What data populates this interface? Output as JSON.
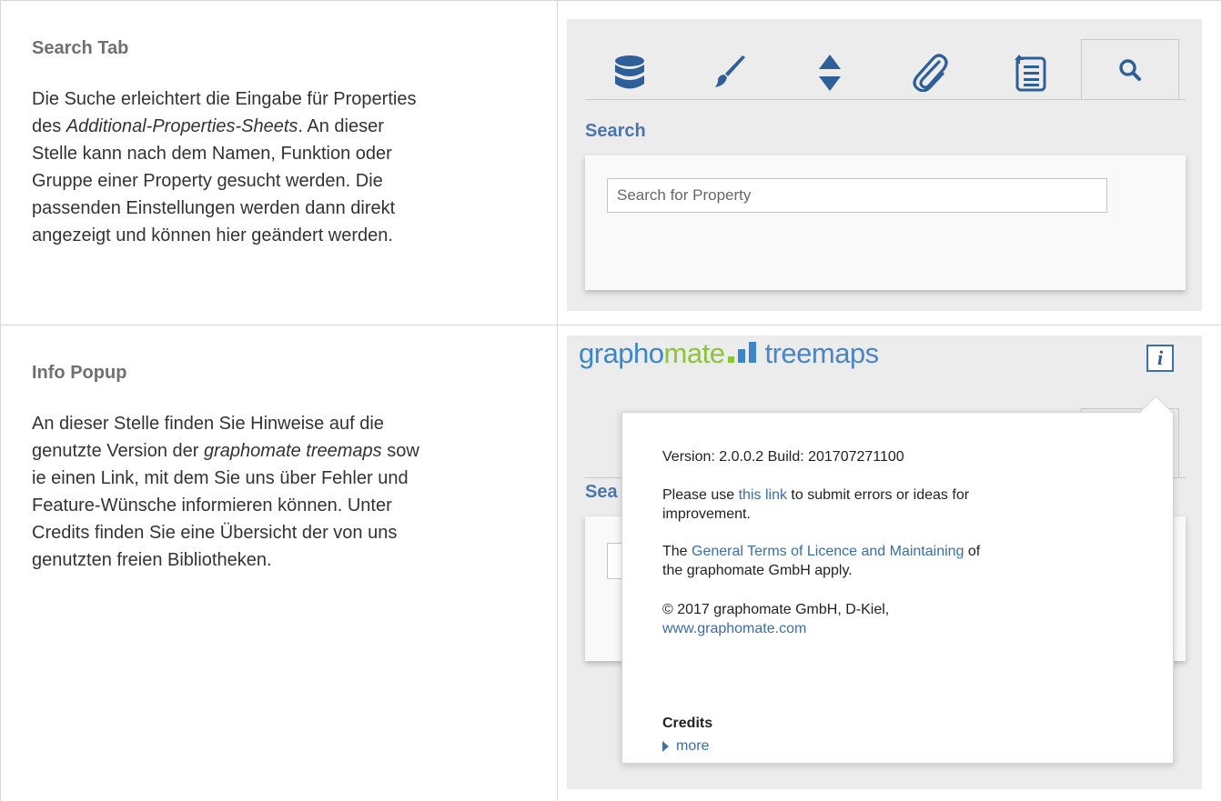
{
  "search_section": {
    "heading": "Search Tab",
    "para_1": "Die Suche erleichtert die Eingabe für Properties",
    "para_2a": "des ",
    "para_2b": "Additional-Properties-Sheets",
    "para_2c": ". An dieser",
    "para_3": "Stelle kann nach dem Namen, Funktion oder",
    "para_4": "Gruppe einer Property gesucht werden. Die",
    "para_5": "passenden Einstellungen werden dann direkt",
    "para_6": "angezeigt und können hier geändert werden.",
    "tabs": [
      {
        "icon": "database-icon"
      },
      {
        "icon": "brush-icon"
      },
      {
        "icon": "sort-icon"
      },
      {
        "icon": "paperclip-icon"
      },
      {
        "icon": "list-icon"
      },
      {
        "icon": "search-icon",
        "active": true
      }
    ],
    "title": "Search",
    "placeholder": "Search for Property"
  },
  "info_section": {
    "heading": "Info Popup",
    "para_1": "An dieser Stelle finden Sie Hinweise auf die",
    "para_2a": "genutzte Version der ",
    "para_2b": "graphomate treemaps",
    "para_2c": " sow",
    "para_3": "ie einen Link, mit dem Sie uns über Fehler und",
    "para_4": "Feature-Wünsche informieren können. Unter",
    "para_5": "Credits finden Sie eine Übersicht der von uns",
    "para_6": "genutzten freien Bibliotheken.",
    "logo": {
      "part1": "grapho",
      "part2": "mate",
      "part3": "treemaps"
    },
    "info_glyph": "i",
    "behind_title": "Sea",
    "popup": {
      "version": "Version: 2.0.0.2 Build: 201707271100",
      "use_pre": "Please use ",
      "use_link": "this link",
      "use_post": " to submit errors or ideas for",
      "use_line2": "improvement.",
      "terms_pre": "The ",
      "terms_link": "General Terms of Licence and Maintaining",
      "terms_post": " of",
      "terms_line2": "the graphomate GmbH apply.",
      "copyright": "© 2017 graphomate GmbH, D-Kiel,",
      "website": "www.graphomate.com",
      "credits": "Credits",
      "more": "more"
    }
  },
  "colors": {
    "accent": "#4a76ae",
    "brand_blue": "#3c86c7",
    "brand_green": "#8cc43c",
    "panel_bg": "#ececec"
  }
}
